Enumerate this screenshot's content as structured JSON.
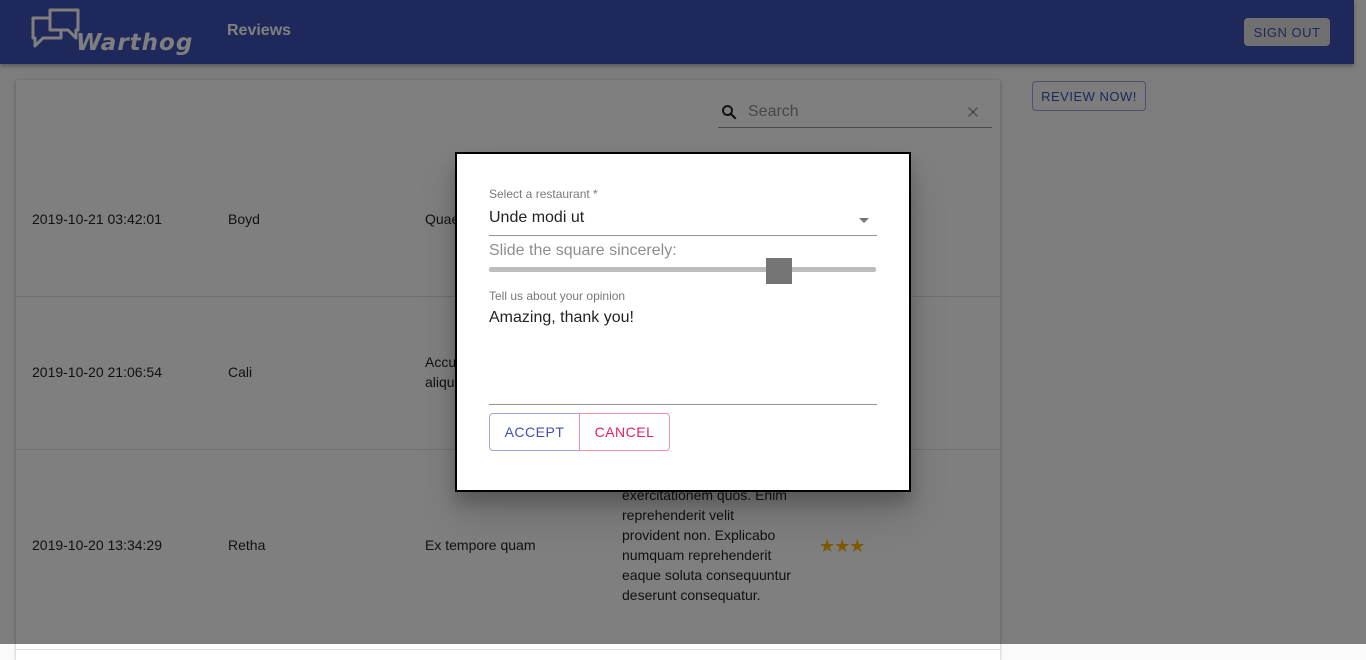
{
  "header": {
    "logo_text": "Warthog",
    "nav_reviews": "Reviews",
    "sign_out": "SIGN OUT",
    "brand_color": "#3f51b5"
  },
  "search": {
    "placeholder": "Search",
    "value": ""
  },
  "review_now": "REVIEW NOW!",
  "table": {
    "rows": [
      {
        "date": "2019-10-21 03:42:01",
        "name": "Boyd",
        "restaurant": "Quae",
        "review": "",
        "stars": ""
      },
      {
        "date": "2019-10-20 21:06:54",
        "name": "Cali",
        "restaurant": "Accu aliqu",
        "review": "",
        "stars": ""
      },
      {
        "date": "2019-10-20 13:34:29",
        "name": "Retha",
        "restaurant": "Ex tempore quam",
        "review": "exercitationem quos. Enim reprehenderit velit provident non. Explicabo numquam reprehenderit eaque soluta consequuntur deserunt consequatur.",
        "stars": "★★★"
      }
    ]
  },
  "dialog": {
    "select_label": "Select a restaurant *",
    "select_value": "Unde modi ut",
    "slider_label": "Slide the square sincerely:",
    "slider_value_fraction": 0.75,
    "opinion_label": "Tell us about your opinion",
    "opinion_value": "Amazing, thank you!",
    "accept": "ACCEPT",
    "cancel": "CANCEL"
  }
}
